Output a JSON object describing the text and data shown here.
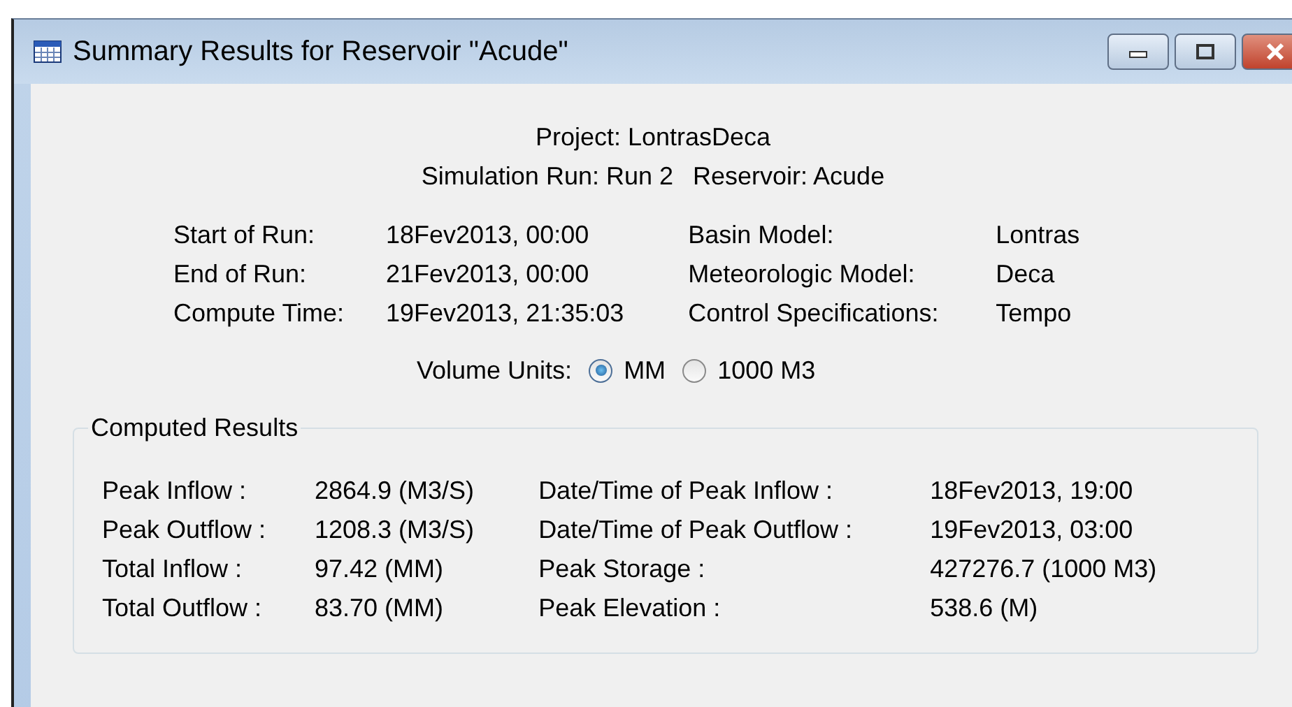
{
  "window": {
    "title": "Summary Results for Reservoir \"Acude\""
  },
  "header": {
    "project": "Project: LontrasDeca",
    "run": "Simulation Run: Run 2",
    "reservoir": "Reservoir: Acude"
  },
  "info_left": [
    {
      "label": "Start of Run:",
      "value": "18Fev2013, 00:00"
    },
    {
      "label": "End of Run:",
      "value": "21Fev2013, 00:00"
    },
    {
      "label": "Compute Time:",
      "value": "19Fev2013, 21:35:03"
    }
  ],
  "info_right": [
    {
      "label": "Basin Model:",
      "value": "Lontras"
    },
    {
      "label": "Meteorologic Model:",
      "value": "Deca"
    },
    {
      "label": "Control Specifications:",
      "value": "Tempo"
    }
  ],
  "volume_units": {
    "label": "Volume Units:",
    "options": [
      {
        "label": "MM",
        "selected": true
      },
      {
        "label": "1000 M3",
        "selected": false
      }
    ]
  },
  "computed_results": {
    "title": "Computed Results",
    "left": [
      {
        "label": "Peak Inflow :",
        "value": "2864.9 (M3/S)"
      },
      {
        "label": "Peak Outflow :",
        "value": "1208.3 (M3/S)"
      },
      {
        "label": "Total Inflow :",
        "value": "97.42 (MM)"
      },
      {
        "label": "Total Outflow :",
        "value": "83.70 (MM)"
      }
    ],
    "right": [
      {
        "label": "Date/Time of Peak Inflow :",
        "value": "18Fev2013, 19:00"
      },
      {
        "label": "Date/Time of Peak Outflow :",
        "value": "19Fev2013, 03:00"
      },
      {
        "label": "Peak Storage :",
        "value": "427276.7 (1000 M3)"
      },
      {
        "label": "Peak Elevation :",
        "value": "538.6 (M)"
      }
    ]
  }
}
